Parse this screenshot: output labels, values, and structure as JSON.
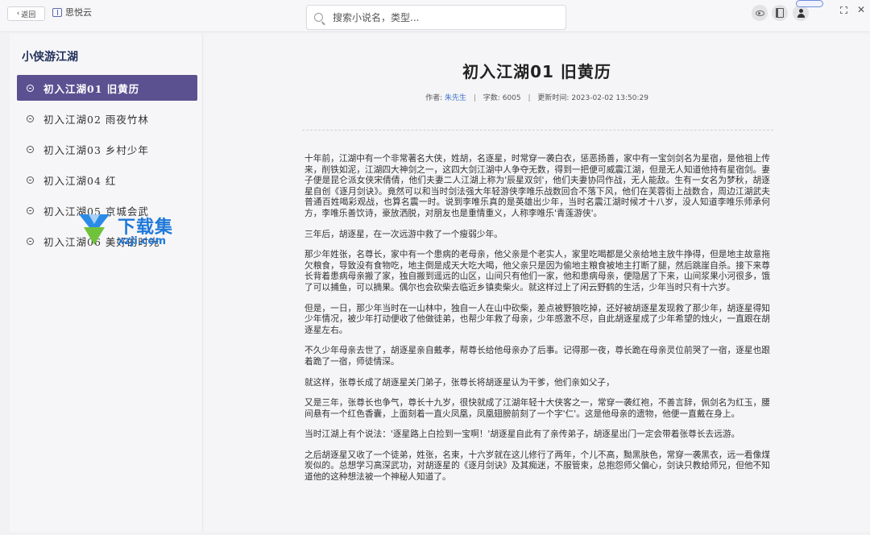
{
  "app": {
    "back_label": "返回",
    "brand_name": "思悦云"
  },
  "search": {
    "placeholder": "搜索小说名，类型..."
  },
  "sidebar": {
    "book_title": "小侠游江湖",
    "chapters": [
      {
        "label": "初入江湖01 旧黄历",
        "active": true
      },
      {
        "label": "初入江湖02 雨夜竹林"
      },
      {
        "label": "初入江湖03 乡村少年"
      },
      {
        "label": "初入江湖04 红"
      },
      {
        "label": "初入江湖05 京城会武"
      },
      {
        "label": "初入江湖06 美好的时光"
      }
    ]
  },
  "watermark": {
    "text": "下载集",
    "sub": "xzji.com"
  },
  "chapter": {
    "title": "初入江湖01 旧黄历",
    "author_label": "作者:",
    "author": "朱先生",
    "words_label": "字数:",
    "words": "6005",
    "updated_label": "更新时间:",
    "updated": "2023-02-02 13:50:29",
    "paragraphs": [
      "十年前，江湖中有一个非常著名大侠，姓胡，名逐星，时常穿一袭白衣，惩恶扬善，家中有一宝剑剑名为星宿，是他祖上传来，削铁如泥，江湖四大神剑之一，这四大剑江湖中人争夺无数，得到一把便可威震江湖，但是无人知道他持有星宿剑。妻子便是昆仑派女侠宋倩倩，他们夫妻二人江湖上称为'辰星双剑'，他们夫妻协同作战，无人能敌。生有一女名为梦秋，胡逐星自创《逐月剑诀》。竟然可以和当时剑法强大年轻游侠李唯乐战数回合不落下风，他们在芙蓉街上战数合，周边江湖武夫普通百姓喝彩观战，也算名震一时。说到李唯乐真的是英雄出少年，当时名震江湖时候才十八岁，没人知道李唯乐师承何方，李唯乐善饮诗，豪放洒脱，对朋友也是重情重义，人称李唯乐'青莲游侠'。",
      "三年后，胡逐星，在一次远游中救了一个瘦弱少年。",
      "那少年姓张，名尊长，家中有一个患病的老母亲，他父亲是个老实人，家里吃喝都是父亲给地主放牛挣得，但是地主故意拖欠粮食，导致没有食物吃，地主倒是成天大吃大喝，他父亲只是因为偷地主粮食被地主打断了腿，然后跳崖自杀。接下来尊长背着患病母亲搬了家，独自搬到遥远的山区，山间只有他们一家，他和患病母亲，便隐居了下来，山间浆果小河很多，饿了可以捕鱼，可以摘果。偶尔也会砍柴去临近乡镇卖柴火。就这样过上了闲云野鹤的生活，少年当时只有十六岁。",
      "但是，一日，那少年当时在一山林中，独自一人在山中砍柴，差点被野狼吃掉，还好被胡逐星发现救了那少年，胡逐星得知少年情况，被少年打动便收了他做徒弟，也帮少年救了母亲，少年感激不尽，自此胡逐星成了少年希望的烛火，一直跟在胡逐星左右。",
      "不久少年母亲去世了，胡逐星亲自戴孝，帮尊长给他母亲办了后事。记得那一夜，尊长跪在母亲灵位前哭了一宿，逐星也跟着跪了一宿，师徒情深。",
      "就这样，张尊长成了胡逐星关门弟子，张尊长将胡逐星认为干爹，他们亲如父子，",
      "又是三年，张尊长也争气，尊长十九岁，很快就成了江湖年轻十大侠客之一，常穿一袭红袍，不善言辞，佩剑名为红玉，腰间悬有一个红色香囊，上面刻着一直火凤凰，凤凰翅膀前刻了一个字'仁'。这是他母亲的遗物，他便一直戴在身上。",
      "当时江湖上有个说法：'逐星路上白捡到一宝啊！'胡逐星自此有了亲传弟子，胡逐星出门一定会带着张尊长去远游。",
      "之后胡逐星又收了一个徒弟，姓张，名束，十六岁就在这儿修行了两年，个儿不高，黝黑肤色，常穿一袭黑衣，远一看像煤炭似的。总想学习高深武功，对胡逐星的《逐月剑诀》及其痴迷，不服管束，总抱怨师父偏心，剑诀只教给师兄，但他不知道他的这种想法被一个神秘人知道了。"
    ]
  },
  "colors": {
    "accent": "#5b5191",
    "title_color": "#23325e",
    "link": "#3f73c9"
  }
}
